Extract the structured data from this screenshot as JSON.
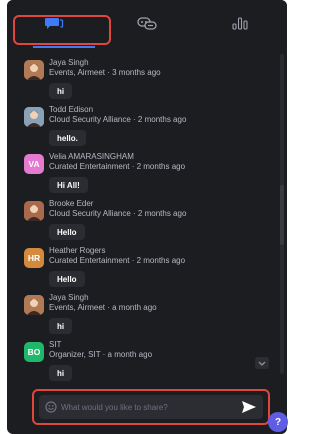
{
  "tabs": [
    {
      "name": "chat",
      "icon": "chat-icon",
      "active": true
    },
    {
      "name": "people",
      "icon": "people-chat-icon",
      "active": false
    },
    {
      "name": "polls",
      "icon": "poll-icon",
      "active": false
    }
  ],
  "messages": [
    {
      "name": "Jaya Singh",
      "meta": "Events, Airmeet · 3 months ago",
      "text": "hi",
      "avatar_type": "photo",
      "avatar_initials": "",
      "avatar_color": "#b07a55"
    },
    {
      "name": "Todd Edison",
      "meta": "Cloud Security Alliance · 2 months ago",
      "text": "hello.",
      "avatar_type": "photo",
      "avatar_initials": "",
      "avatar_color": "#8aa2b8"
    },
    {
      "name": "Velia AMARASINGHAM",
      "meta": "Curated Entertainment · 2 months ago",
      "text": "Hi All!",
      "avatar_type": "initials",
      "avatar_initials": "VA",
      "avatar_color": "#e57ad1"
    },
    {
      "name": "Brooke Eder",
      "meta": "Cloud Security Alliance · 2 months ago",
      "text": "Hello",
      "avatar_type": "photo",
      "avatar_initials": "",
      "avatar_color": "#a86a4a"
    },
    {
      "name": "Heather Rogers",
      "meta": "Curated Entertainment · 2 months ago",
      "text": "Hello",
      "avatar_type": "initials",
      "avatar_initials": "HR",
      "avatar_color": "#d48a3c"
    },
    {
      "name": "Jaya Singh",
      "meta": "Events, Airmeet · a month ago",
      "text": "hi",
      "avatar_type": "photo",
      "avatar_initials": "",
      "avatar_color": "#b07a55"
    },
    {
      "name": "SIT",
      "meta": "Organizer, SIT · a month ago",
      "text": "hi",
      "avatar_type": "initials",
      "avatar_initials": "BO",
      "avatar_color": "#1fb86a"
    }
  ],
  "composer": {
    "placeholder": "What would you like to share?",
    "value": ""
  },
  "help_label": "?",
  "colors": {
    "panel_bg": "#1c1d21",
    "bubble_bg": "#2b2c31",
    "highlight_outline": "#e0463b",
    "tab_accent": "#3f7bf6",
    "help_button": "#5f5ce6"
  }
}
